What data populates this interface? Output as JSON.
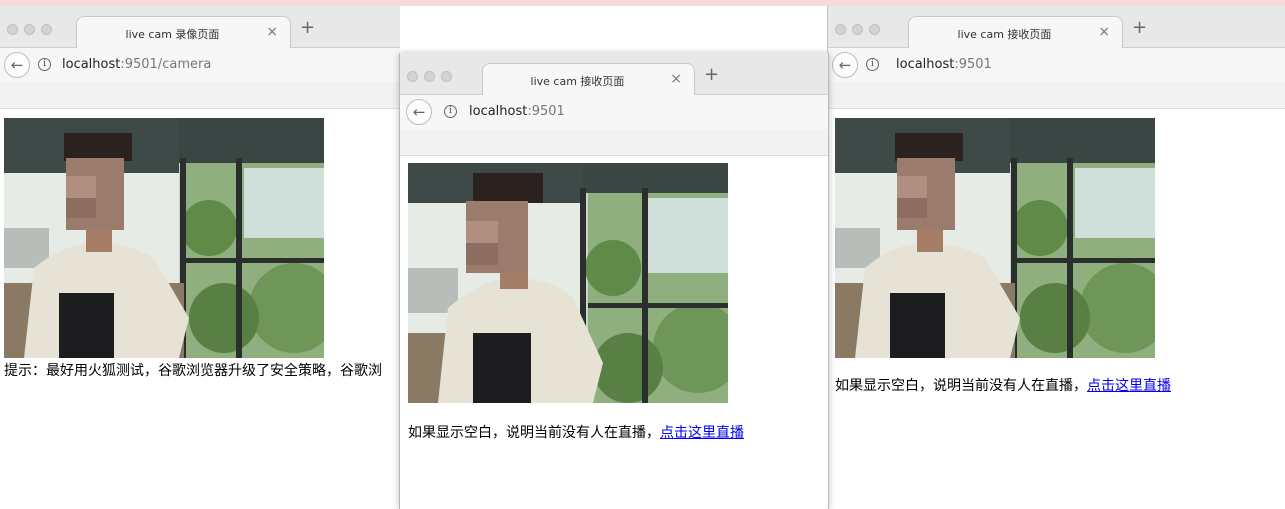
{
  "windows": [
    {
      "tab_title": "live cam 录像页面",
      "url_host": "localhost",
      "url_rest": ":9501/camera",
      "hint_text": "提示：最好用火狐测试，谷歌浏览器升级了安全策略，谷歌浏",
      "link_text": ""
    },
    {
      "tab_title": "live cam 接收页面",
      "url_host": "localhost",
      "url_rest": ":9501",
      "hint_text": "如果显示空白，说明当前没有人在直播，",
      "link_text": "点击这里直播"
    },
    {
      "tab_title": "live cam 接收页面",
      "url_host": "localhost",
      "url_rest": ":9501",
      "hint_text": "如果显示空白，说明当前没有人在直播，",
      "link_text": "点击这里直播"
    }
  ],
  "icons": {
    "close": "×",
    "new_tab": "+",
    "back": "←",
    "info": "i"
  }
}
